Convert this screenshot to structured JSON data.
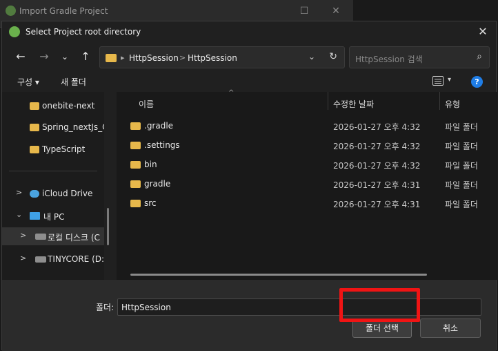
{
  "back_window": {
    "title": "Import Gradle Project"
  },
  "dialog": {
    "title": "Select Project root directory",
    "breadcrumb": [
      "HttpSession",
      "HttpSession"
    ],
    "search_placeholder": "HttpSession 검색",
    "command_bar": {
      "organize": "구성",
      "new_folder": "새 폴더"
    },
    "sidebar": [
      {
        "label": "onebite-next",
        "kind": "folder"
      },
      {
        "label": "Spring_nextJs_Cl",
        "kind": "folder"
      },
      {
        "label": "TypeScript",
        "kind": "folder"
      },
      {
        "label": "iCloud Drive",
        "kind": "cloud"
      },
      {
        "label": "내 PC",
        "kind": "pc"
      },
      {
        "label": "로컬 디스크 (C",
        "kind": "drive"
      },
      {
        "label": "TINYCORE (D:)",
        "kind": "drive"
      }
    ],
    "columns": {
      "name": "이름",
      "modified": "수정한 날짜",
      "type": "유형"
    },
    "files": [
      {
        "name": ".gradle",
        "modified": "2026-01-27 오후 4:32",
        "type": "파일 폴더"
      },
      {
        "name": ".settings",
        "modified": "2026-01-27 오후 4:32",
        "type": "파일 폴더"
      },
      {
        "name": "bin",
        "modified": "2026-01-27 오후 4:32",
        "type": "파일 폴더"
      },
      {
        "name": "gradle",
        "modified": "2026-01-27 오후 4:31",
        "type": "파일 폴더"
      },
      {
        "name": "src",
        "modified": "2026-01-27 오후 4:31",
        "type": "파일 폴더"
      }
    ],
    "folder_label": "폴더:",
    "folder_value": "HttpSession",
    "select_button": "폴더 선택",
    "cancel_button": "취소"
  },
  "colors": {
    "folder": "#e7b84b",
    "highlight": "#f01414",
    "help": "#1f7de6"
  }
}
